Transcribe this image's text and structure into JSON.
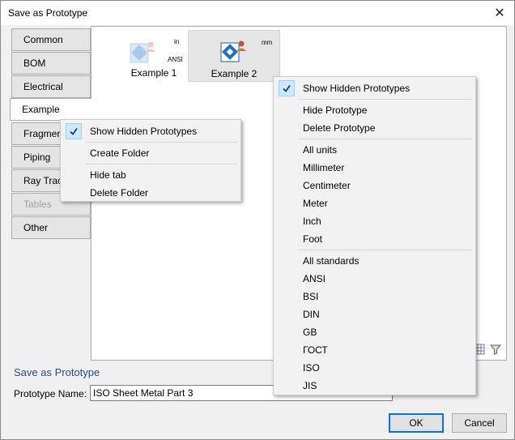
{
  "window": {
    "title": "Save as Prototype",
    "close_glyph": "✕"
  },
  "tabs": [
    {
      "label": "Common"
    },
    {
      "label": "BOM"
    },
    {
      "label": "Electrical"
    },
    {
      "label": "Example"
    },
    {
      "label": "Fragmer"
    },
    {
      "label": "Piping"
    },
    {
      "label": "Ray Trac"
    },
    {
      "label": "Tables"
    },
    {
      "label": "Other"
    }
  ],
  "prototypes": [
    {
      "label": "Example 1",
      "unit": "in",
      "standard": "ANSI",
      "icon": "prototype-icon"
    },
    {
      "label": "Example 2",
      "unit": "mm",
      "standard": "",
      "icon": "prototype-icon"
    }
  ],
  "view_icons": [
    "large-icons-view-icon",
    "grid-view-icon",
    "filter-icon"
  ],
  "tab_menu": {
    "items": [
      {
        "label": "Show Hidden Prototypes",
        "checked": true
      },
      {
        "label": "Create Folder"
      },
      {
        "label": "Hide tab"
      },
      {
        "label": "Delete Folder"
      }
    ]
  },
  "content_menu": {
    "items": [
      {
        "label": "Show Hidden Prototypes",
        "checked": true
      },
      {
        "label": "Hide Prototype"
      },
      {
        "label": "Delete Prototype"
      },
      {
        "label": "All units"
      },
      {
        "label": "Millimeter"
      },
      {
        "label": "Centimeter"
      },
      {
        "label": "Meter"
      },
      {
        "label": "Inch"
      },
      {
        "label": "Foot"
      },
      {
        "label": "All standards"
      },
      {
        "label": "ANSI"
      },
      {
        "label": "BSI"
      },
      {
        "label": "DIN"
      },
      {
        "label": "GB"
      },
      {
        "label": "ГОСТ"
      },
      {
        "label": "ISO"
      },
      {
        "label": "JIS"
      }
    ]
  },
  "form": {
    "section_title": "Save as Prototype",
    "name_label": "Prototype Name:",
    "name_value": "ISO Sheet Metal Part 3"
  },
  "buttons": {
    "ok": "OK",
    "cancel": "Cancel"
  },
  "colors": {
    "accent": "#0078d7",
    "section_title": "#1e4e8c",
    "menu_check_bg": "#cde8ff"
  }
}
